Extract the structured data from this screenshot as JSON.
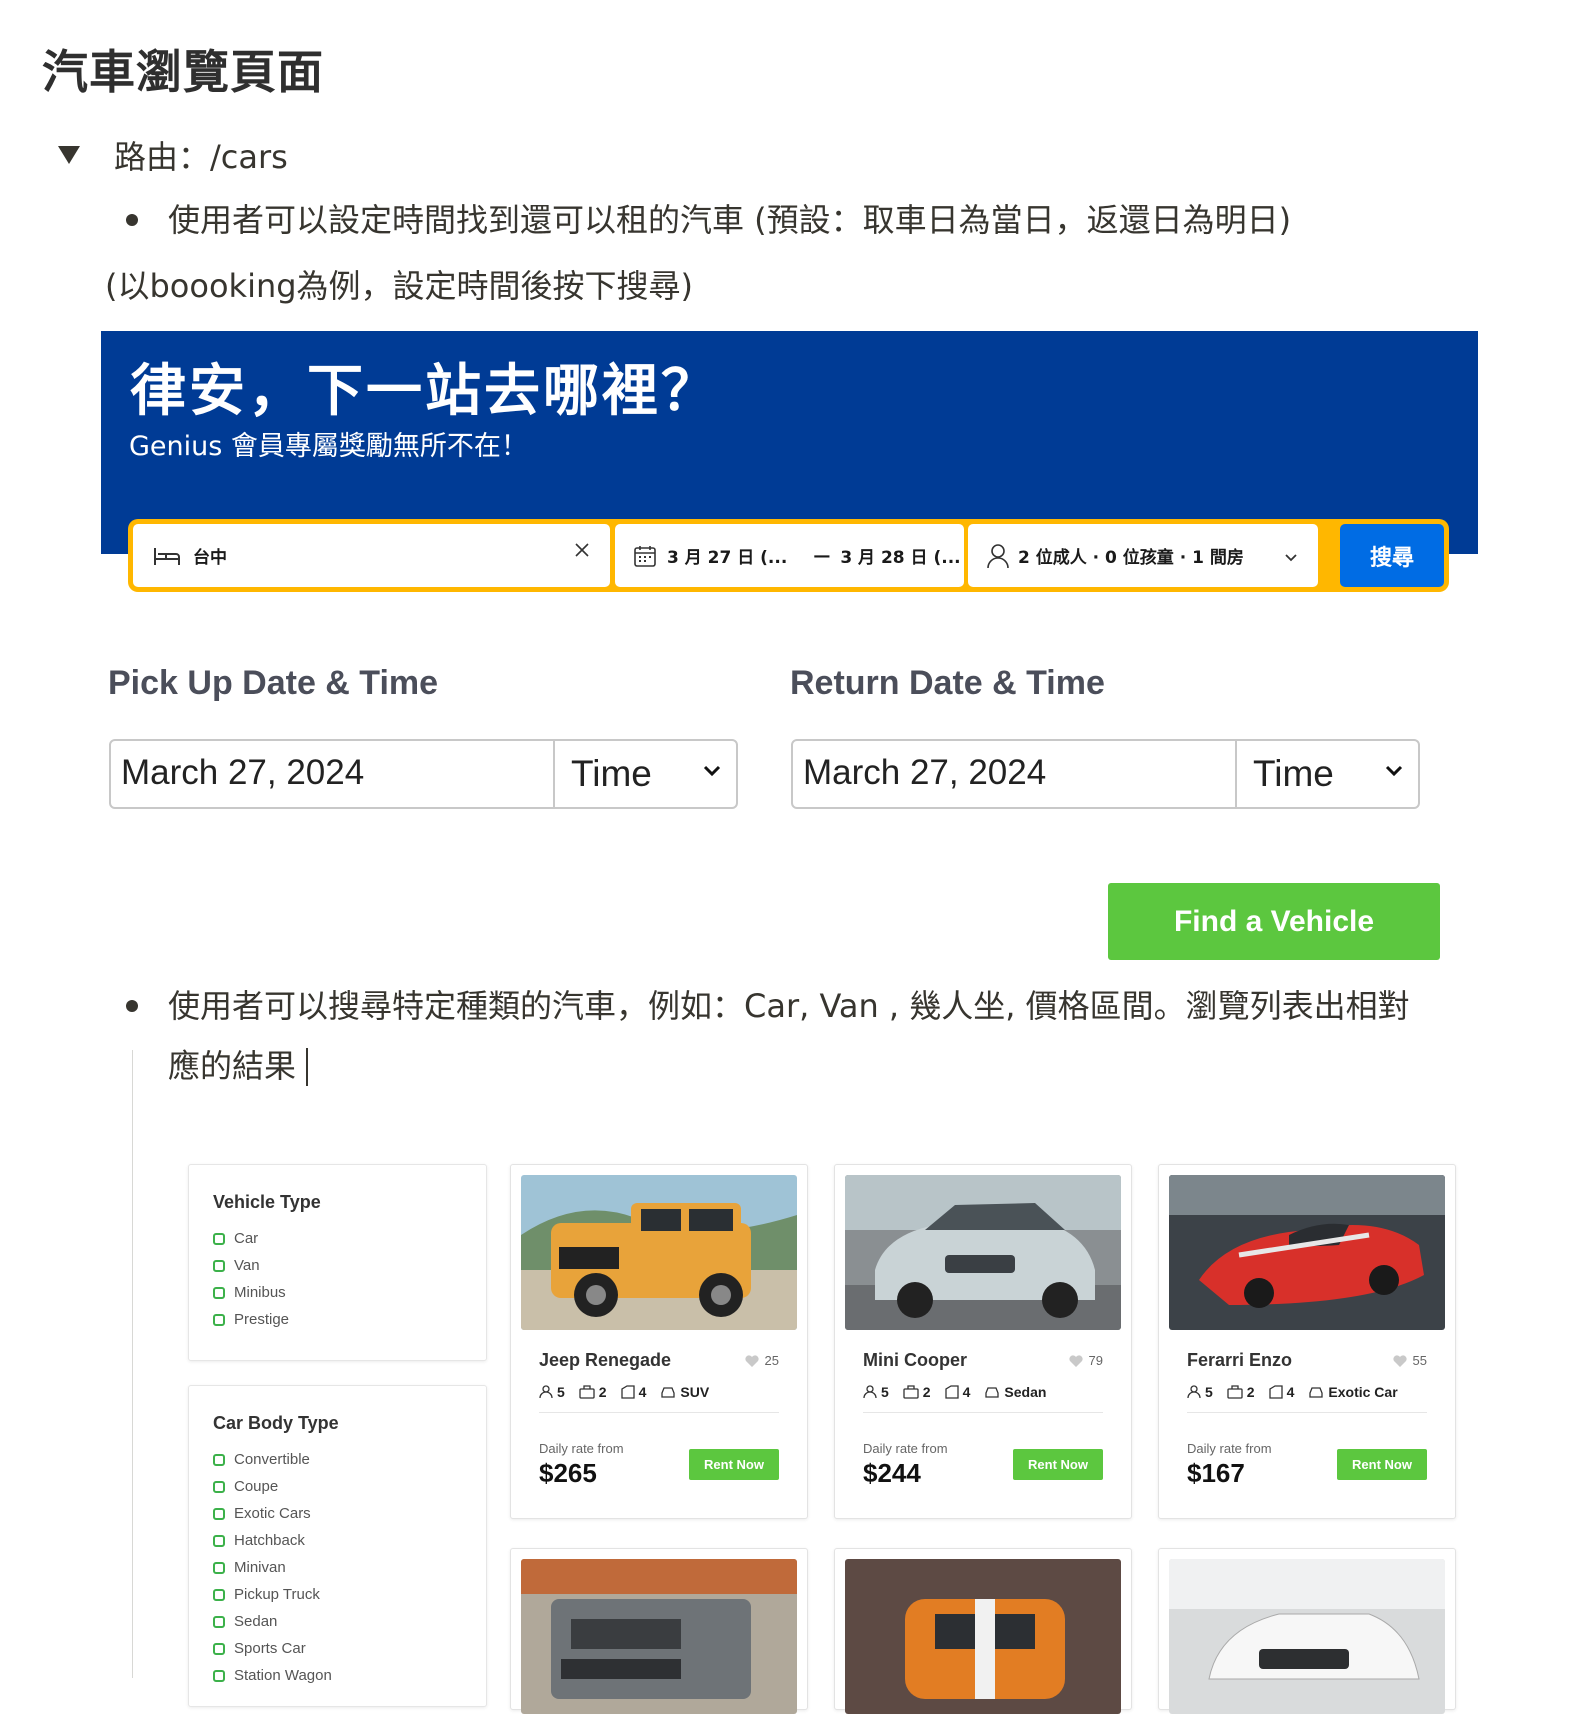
{
  "page": {
    "title": "汽車瀏覽頁面",
    "route_label": "路由：/cars",
    "bullet1": "使用者可以設定時間找到還可以租的汽車 (預設：取車日為當日，返還日為明日)",
    "note1": "(以boooking為例，設定時間後按下搜尋)",
    "bullet2_line1": "使用者可以搜尋特定種類的汽車，例如：Car, Van , 幾人坐, 價格區間。瀏覽列表出相對",
    "bullet2_line2": "應的結果"
  },
  "booking": {
    "headline": "律安，下一站去哪裡？",
    "subline": "Genius 會員專屬獎勵無所不在！",
    "destination": "台中",
    "date_from": "3 月 27 日 (...",
    "date_to": "3 月 28 日 (...",
    "date_dash": "—",
    "guests": "2 位成人 · 0 位孩童 · 1 間房",
    "search_label": "搜尋"
  },
  "rental_form": {
    "pickup_label": "Pick Up Date & Time",
    "return_label": "Return Date & Time",
    "pickup_date": "March 27, 2024",
    "pickup_time": "Time",
    "return_date": "March 27, 2024",
    "return_time": "Time",
    "find_label": "Find a Vehicle"
  },
  "filters": {
    "vehicle_type": {
      "title": "Vehicle Type",
      "options": [
        "Car",
        "Van",
        "Minibus",
        "Prestige"
      ]
    },
    "body_type": {
      "title": "Car Body Type",
      "options": [
        "Convertible",
        "Coupe",
        "Exotic Cars",
        "Hatchback",
        "Minivan",
        "Pickup Truck",
        "Sedan",
        "Sports Car",
        "Station Wagon"
      ]
    }
  },
  "cars": [
    {
      "name": "Jeep Renegade",
      "likes": "25",
      "seats": "5",
      "bags": "2",
      "doors": "4",
      "type": "SUV",
      "rate_label": "Daily rate from",
      "price": "$265",
      "rent_label": "Rent Now",
      "color": "#e8a33a"
    },
    {
      "name": "Mini Cooper",
      "likes": "79",
      "seats": "5",
      "bags": "2",
      "doors": "4",
      "type": "Sedan",
      "rate_label": "Daily rate from",
      "price": "$244",
      "rent_label": "Rent Now",
      "color": "#c9d3d6"
    },
    {
      "name": "Ferarri Enzo",
      "likes": "55",
      "seats": "5",
      "bags": "2",
      "doors": "4",
      "type": "Exotic Car",
      "rate_label": "Daily rate from",
      "price": "$167",
      "rent_label": "Rent Now",
      "color": "#d8302a"
    }
  ],
  "colors": {
    "booking_blue": "#003b95",
    "booking_yellow": "#ffb700",
    "search_blue": "#006ce4",
    "rent_green": "#5cc73f"
  }
}
